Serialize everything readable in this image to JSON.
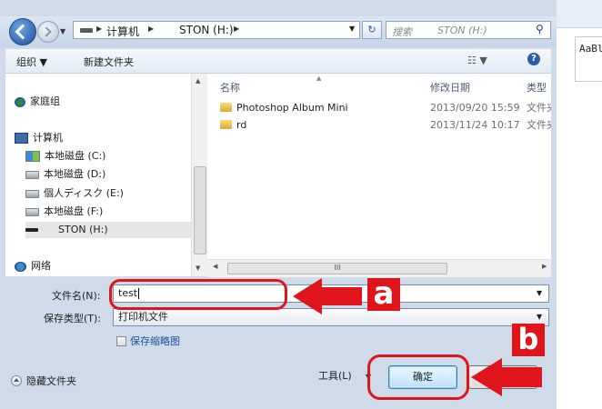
{
  "address_bar": {
    "crumbs": [
      "计算机",
      "STON (H:)"
    ],
    "search_placeholder_1": "搜索",
    "search_placeholder_2": "STON (H:)"
  },
  "toolbar": {
    "organize_label": "组织 ▼",
    "new_folder_label": "新建文件夹",
    "view_label": "☷ ▼",
    "help_label": "?"
  },
  "nav_pane": {
    "items": [
      {
        "label": "家庭组",
        "icon": "homegroup-icon"
      },
      {
        "label": "计算机",
        "icon": "computer-icon"
      },
      {
        "label": "本地磁盘 (C:)",
        "icon": "system-drive-icon"
      },
      {
        "label": "本地磁盘 (D:)",
        "icon": "drive-icon"
      },
      {
        "label": "個人ディスク (E:)",
        "icon": "drive-icon"
      },
      {
        "label": "本地磁盘 (F:)",
        "icon": "drive-icon"
      },
      {
        "label": "STON (H:)",
        "icon": "usb-drive-icon",
        "selected": true
      },
      {
        "label": "网络",
        "icon": "network-icon"
      }
    ]
  },
  "file_pane": {
    "columns": [
      "名称",
      "修改日期",
      "类型"
    ],
    "rows": [
      {
        "name": "Photoshop Album Mini",
        "date": "2013/09/20 15:59",
        "type": "文件夹"
      },
      {
        "name": "rd",
        "date": "2013/11/24 10:17",
        "type": "文件夹"
      }
    ],
    "hscroll_grip": "III"
  },
  "form": {
    "filename_label": "文件名(N):",
    "filename_value": "test",
    "filetype_label": "保存类型(T):",
    "filetype_value": "打印机文件",
    "save_thumbnail_label": "保存缩略图",
    "hide_folders_label": "隐藏文件夹",
    "tools_label": "工具(L)",
    "ok_label": "确定"
  },
  "annotations": {
    "label_a": "a",
    "label_b": "b",
    "color": "#e0141b"
  },
  "background_app": {
    "style_preview": "AaBl"
  }
}
